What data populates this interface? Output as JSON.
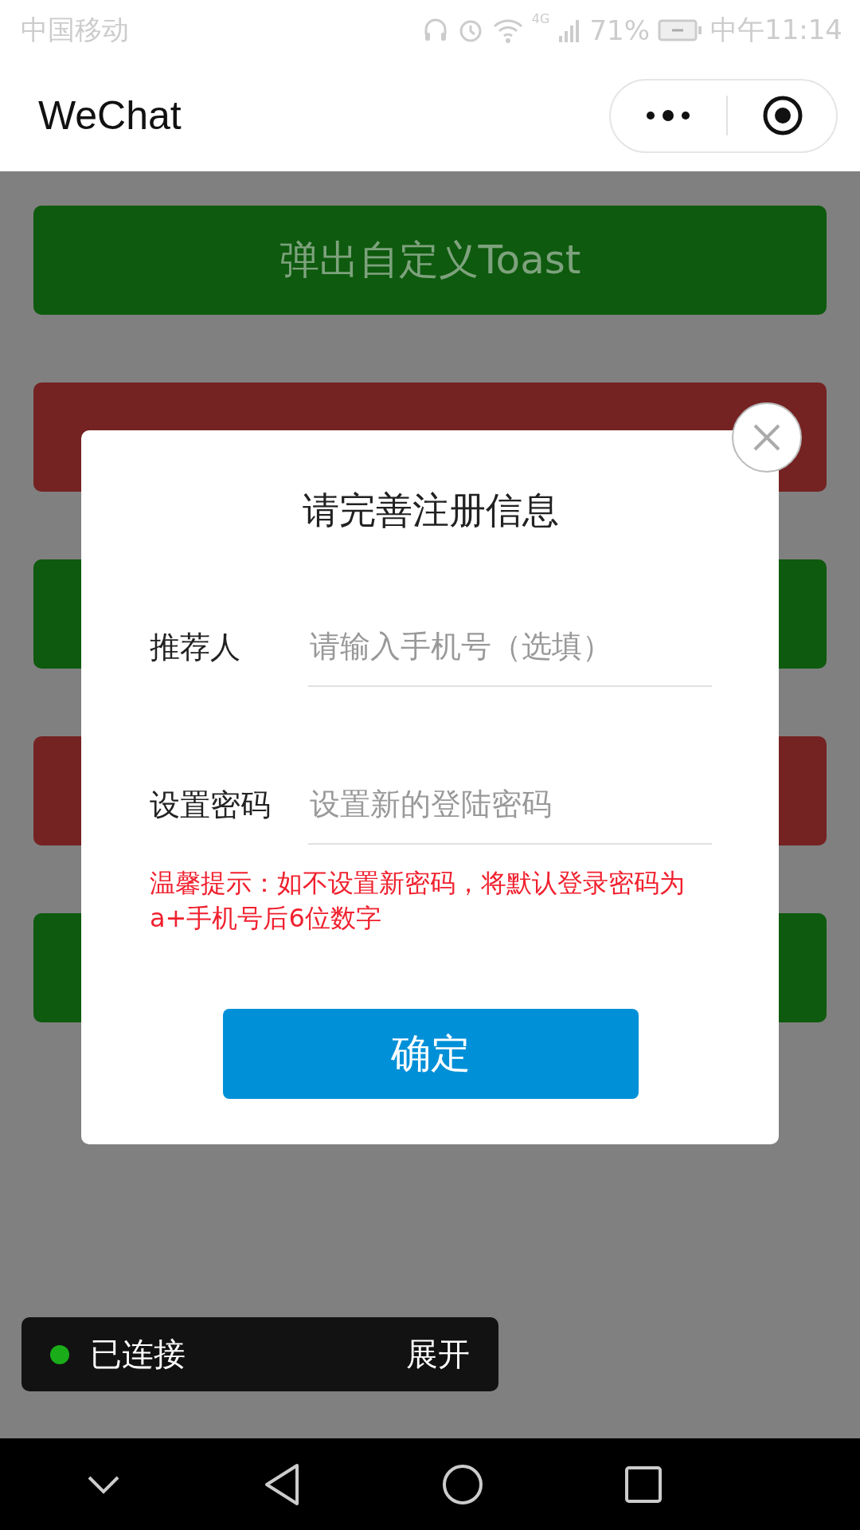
{
  "status_bar": {
    "carrier": "中国移动",
    "network": "4G",
    "battery": "71%",
    "time": "中午11:14"
  },
  "header": {
    "title": "WeChat"
  },
  "buttons": [
    {
      "label": "弹出自定义Toast",
      "kind": "green"
    },
    {
      "kind": "red"
    },
    {
      "kind": "green"
    },
    {
      "kind": "red"
    },
    {
      "kind": "green"
    }
  ],
  "modal": {
    "title": "请完善注册信息",
    "fields": [
      {
        "label": "推荐人",
        "placeholder": "请输入手机号（选填）"
      },
      {
        "label": "设置密码",
        "placeholder": "设置新的登陆密码"
      }
    ],
    "hint": "温馨提示：如不设置新密码，将默认登录密码为a+手机号后6位数字",
    "confirm": "确定"
  },
  "toast": {
    "status": "已连接",
    "action": "展开"
  }
}
